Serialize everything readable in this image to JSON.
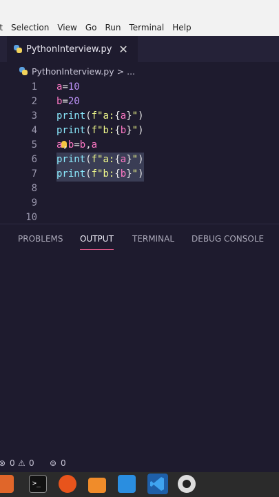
{
  "menubar": [
    "it",
    "Selection",
    "View",
    "Go",
    "Run",
    "Terminal",
    "Help"
  ],
  "tab": {
    "filename": "PythonInterview.py",
    "close": "✕"
  },
  "breadcrumb": {
    "filename": "PythonInterview.py",
    "separator": ">",
    "more": "..."
  },
  "editor": {
    "line_numbers": [
      "1",
      "2",
      "3",
      "4",
      "5",
      "6",
      "7",
      "8",
      "9",
      "10"
    ],
    "lines": [
      "a=10",
      "b=20",
      "print(f\"a:{a}\")",
      "print(f\"b:{b}\")",
      "a,b=b,a",
      "print(f\"a:{a}\")",
      "print(f\"b:{b}\")",
      "",
      "",
      ""
    ],
    "selected_lines": [
      6,
      7
    ]
  },
  "panel": {
    "tabs": [
      "PROBLEMS",
      "OUTPUT",
      "TERMINAL",
      "DEBUG CONSOLE"
    ],
    "active": "OUTPUT"
  },
  "status": {
    "errors": "0",
    "warnings": "0",
    "ports": "0"
  },
  "colors": {
    "accent": "#e05a8a",
    "editor_bg": "#1e1b2e",
    "keyword_pink": "#ff79c6",
    "builtin_cyan": "#8be9fd",
    "string_yellow": "#f1fa8c",
    "number_purple": "#bd93f9"
  },
  "taskbar_icons": [
    "files-icon",
    "terminal-icon",
    "firefox-icon",
    "folder-icon",
    "editor-icon",
    "vscode-icon",
    "camera-icon"
  ]
}
